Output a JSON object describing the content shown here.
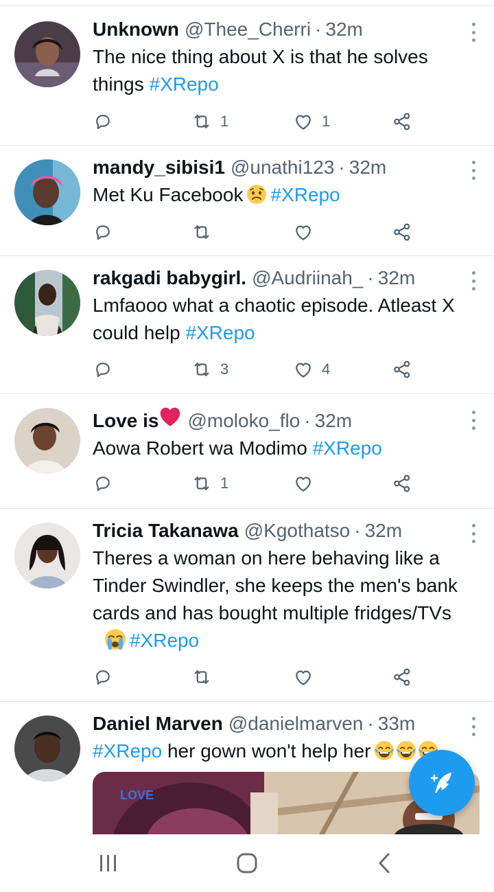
{
  "tweets": [
    {
      "name": "Unknown",
      "handle": "@Thee_Cherri",
      "time": "32m",
      "text": "The nice thing about X is that he solves things",
      "hashtag": "#XRepo",
      "retweets": "1",
      "likes": "1"
    },
    {
      "name": "mandy_sibisi1",
      "handle": "@unathi123",
      "time": "32m",
      "text": "Met Ku Facebook",
      "hashtag": "#XRepo",
      "emoji": "sad-face-emoji",
      "retweets": "",
      "likes": ""
    },
    {
      "name": "rakgadi babygirl.",
      "handle": "@Audriinah_",
      "time": "32m",
      "text": "Lmfaooo what a chaotic episode. Atleast X could help",
      "hashtag": "#XRepo",
      "retweets": "3",
      "likes": "4"
    },
    {
      "name": "Love is",
      "name_emoji": "red-heart-emoji",
      "handle": "@moloko_flo",
      "time": "32m",
      "text": "Aowa Robert wa Modimo",
      "hashtag": "#XRepo",
      "retweets": "1",
      "likes": ""
    },
    {
      "name": "Tricia Takanawa",
      "handle": "@Kgothatso",
      "time": "32m",
      "text": "Theres a woman on here behaving like a Tinder Swindler, she keeps the men's bank cards and has bought multiple fridges/TVs",
      "hashtag": "#XRepo",
      "emoji": "crying-face-emoji",
      "retweets": "",
      "likes": ""
    },
    {
      "name": "Daniel Marven",
      "handle": "@danielmarven",
      "time": "33m",
      "hashtag": "#XRepo",
      "text": "her gown won't help her",
      "emoji": "tears-of-joy-emoji"
    }
  ],
  "media_overlay_text": "LOVE",
  "icons": {
    "reply": "reply-icon",
    "retweet": "retweet-icon",
    "like": "heart-icon",
    "share": "share-icon",
    "more": "more-options-icon",
    "compose": "compose-tweet-icon",
    "nav_recents": "recents-icon",
    "nav_home": "home-icon",
    "nav_back": "back-icon"
  },
  "colors": {
    "accent": "#1d9bf0",
    "text": "#0f1419",
    "secondary": "#536471",
    "divider": "#e1e5e8"
  }
}
